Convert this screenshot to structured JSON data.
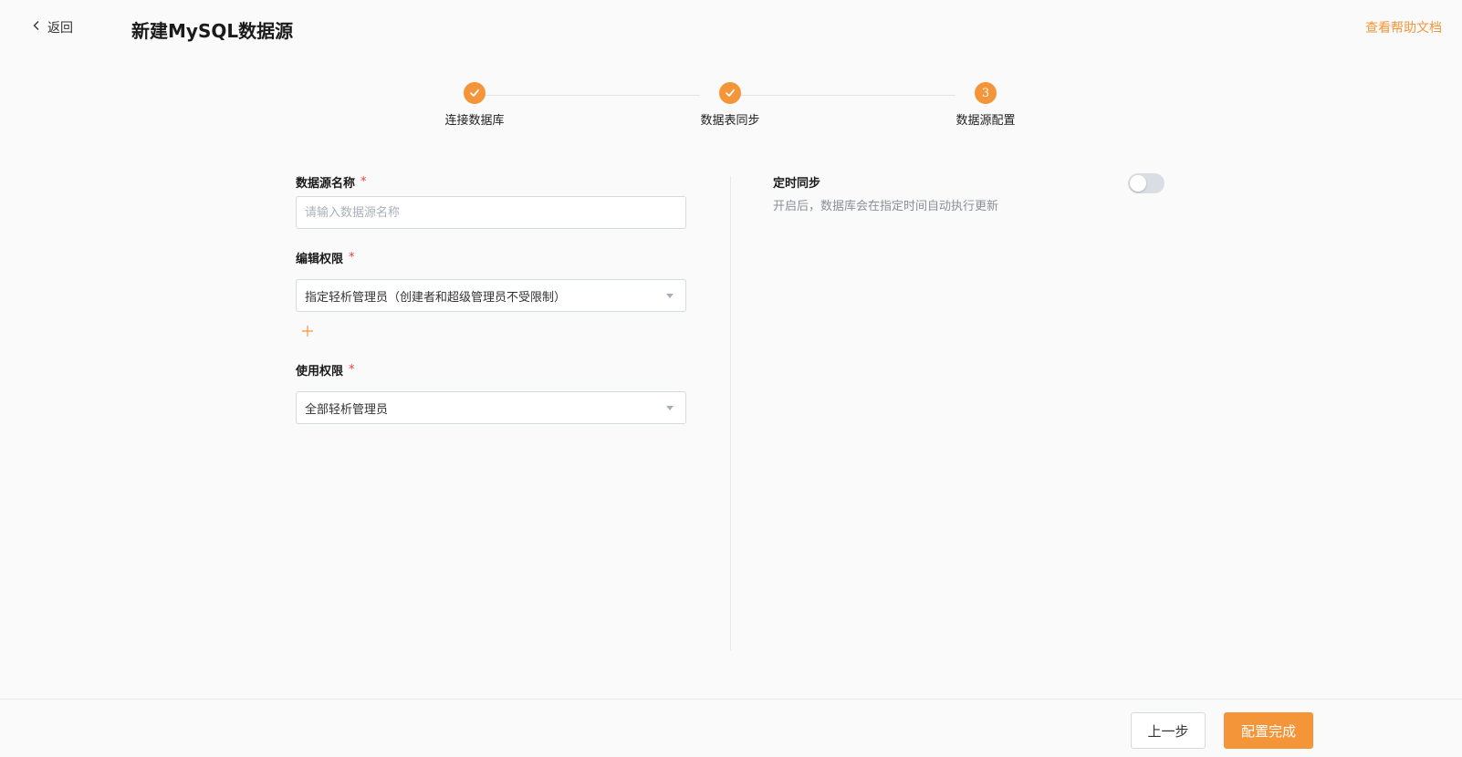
{
  "header": {
    "back_label": "返回",
    "title": "新建MySQL数据源",
    "help_link": "查看帮助文档"
  },
  "steps": [
    {
      "label": "连接数据库",
      "status": "done"
    },
    {
      "label": "数据表同步",
      "status": "done"
    },
    {
      "label": "数据源配置",
      "status": "current",
      "number": "3"
    }
  ],
  "form": {
    "name": {
      "label": "数据源名称",
      "required": "*",
      "placeholder": "请输入数据源名称",
      "value": ""
    },
    "edit_permission": {
      "label": "编辑权限",
      "required": "*",
      "selected": "指定轻析管理员（创建者和超级管理员不受限制）"
    },
    "use_permission": {
      "label": "使用权限",
      "required": "*",
      "selected": "全部轻析管理员"
    }
  },
  "sync": {
    "title": "定时同步",
    "description": "开启后，数据库会在指定时间自动执行更新",
    "enabled": false
  },
  "footer": {
    "prev_label": "上一步",
    "done_label": "配置完成"
  },
  "colors": {
    "accent": "#f5953a",
    "required": "#e34040",
    "muted": "#8a8f98"
  }
}
